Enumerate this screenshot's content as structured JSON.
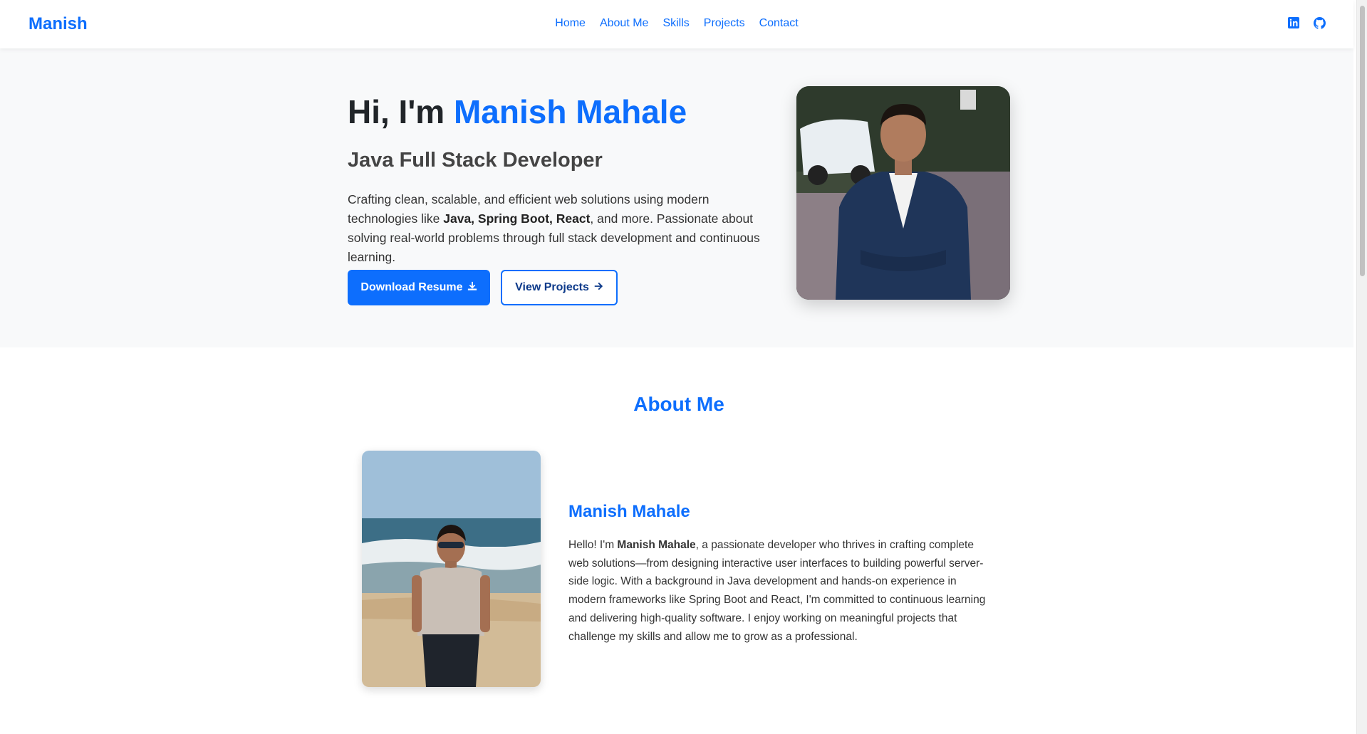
{
  "nav": {
    "brand": "Manish",
    "links": [
      "Home",
      "About Me",
      "Skills",
      "Projects",
      "Contact"
    ],
    "icons": [
      "linkedin-icon",
      "github-icon"
    ]
  },
  "hero": {
    "greeting": "Hi, I'm ",
    "name": "Manish Mahale",
    "role": "Java Full Stack Developer",
    "desc_start": "Crafting clean, scalable, and efficient web solutions using modern technologies like ",
    "desc_bold": "Java, Spring Boot, React",
    "desc_end": ", and more. Passionate about solving real-world problems through full stack development and continuous learning.",
    "btn_resume": "Download Resume",
    "btn_projects": "View Projects"
  },
  "about": {
    "title": "About Me",
    "name": "Manish Mahale",
    "text_start": "Hello! I'm ",
    "text_bold": "Manish Mahale",
    "text_end": ", a passionate developer who thrives in crafting complete web solutions—from designing interactive user interfaces to building powerful server-side logic. With a background in Java development and hands-on experience in modern frameworks like Spring Boot and React, I'm committed to continuous learning and delivering high-quality software. I enjoy working on meaningful projects that challenge my skills and allow me to grow as a professional."
  },
  "colors": {
    "accent": "#0d6efd",
    "hero_bg": "#f8f9fa"
  }
}
